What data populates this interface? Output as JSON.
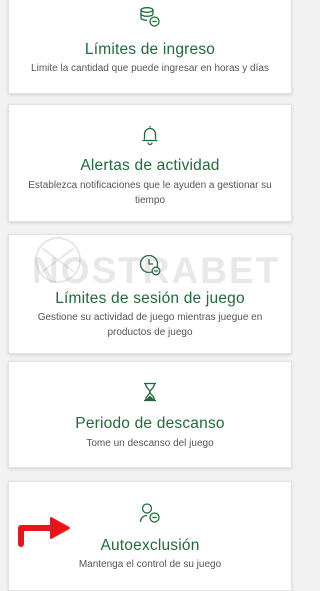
{
  "cards": [
    {
      "title": "Límites de ingreso",
      "description": "Limite la cantidad que puede ingresar en horas y días",
      "icon": "coins-minus-icon"
    },
    {
      "title": "Alertas de actividad",
      "description": "Establezca notificaciones que le ayuden a gestionar su tiempo",
      "icon": "bell-icon"
    },
    {
      "title": "Límites de sesión de juego",
      "description": "Gestione su actividad de juego mientras juegue en productos de juego",
      "icon": "clock-icon"
    },
    {
      "title": "Periodo de descanso",
      "description": "Tome un descanso del juego",
      "icon": "hourglass-icon"
    },
    {
      "title": "Autoexclusión",
      "description": "Mantenga el control de su juego",
      "icon": "person-minus-icon"
    }
  ],
  "watermark": "NOSTRABET",
  "colors": {
    "accent": "#1f6b3a",
    "text": "#555555",
    "background": "#f2f2f2",
    "arrow": "#e8141c"
  }
}
